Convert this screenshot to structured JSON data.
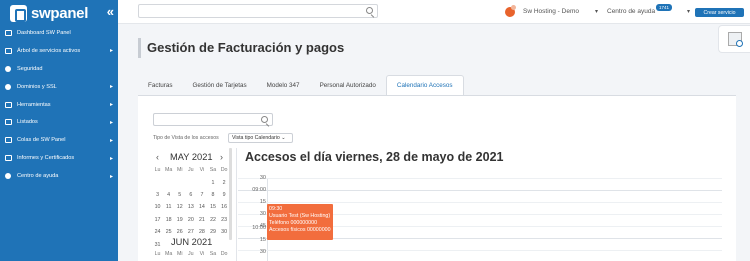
{
  "brand": {
    "name": "swpanel",
    "accent": "#1f73b7",
    "event_color": "#f26d3d"
  },
  "sidebar": {
    "collapse_icon": "double-chevron-left",
    "items": [
      {
        "label": "Dashboard SW Panel",
        "icon": "dashboard-icon",
        "caret": ""
      },
      {
        "label": "Árbol de servicios activos",
        "icon": "tree-icon",
        "caret": "▸"
      },
      {
        "label": "Seguridad",
        "icon": "shield-icon",
        "caret": ""
      },
      {
        "label": "Dominios y SSL",
        "icon": "gear-icon",
        "caret": "▸"
      },
      {
        "label": "Herramientas",
        "icon": "tools-icon",
        "caret": "▸"
      },
      {
        "label": "Listados",
        "icon": "list-icon",
        "caret": "▸"
      },
      {
        "label": "Colas de SW Panel",
        "icon": "layers-icon",
        "caret": "▸"
      },
      {
        "label": "Informes y Certificados",
        "icon": "report-icon",
        "caret": "▸"
      },
      {
        "label": "Centro de ayuda",
        "icon": "help-icon",
        "caret": "▸"
      }
    ]
  },
  "topbar": {
    "search_placeholder": "",
    "account": "Sw Hosting - Demo",
    "account_caret": "▾",
    "help": "Centro de ayuda",
    "help_badge": "1741",
    "help_caret": "▾",
    "new_service": "Crear servicio"
  },
  "page": {
    "title": "Gestión de Facturación y pagos",
    "tabs": [
      {
        "label": "Facturas"
      },
      {
        "label": "Gestión de Tarjetas"
      },
      {
        "label": "Modelo 347"
      },
      {
        "label": "Personal Autorizado"
      },
      {
        "label": "Calendario Accesos"
      }
    ],
    "active_tab": "Calendario Accesos"
  },
  "accesses": {
    "search_value": "",
    "view_label": "Tipo de Vista de los accesos",
    "view_value": "Vista tipo Calendario",
    "month1": "MAY 2021",
    "month2": "JUN 2021",
    "prev": "‹",
    "next": "›",
    "weekdays": [
      "Lu",
      "Ma",
      "Mi",
      "Ju",
      "Vi",
      "Sa",
      "Do"
    ],
    "may_weeks": [
      [
        "",
        "",
        "",
        "",
        "",
        "1",
        "2"
      ],
      [
        "3",
        "4",
        "5",
        "6",
        "7",
        "8",
        "9"
      ],
      [
        "10",
        "11",
        "12",
        "13",
        "14",
        "15",
        "16"
      ],
      [
        "17",
        "18",
        "19",
        "20",
        "21",
        "22",
        "23"
      ],
      [
        "24",
        "25",
        "26",
        "27",
        "28",
        "29",
        "30"
      ],
      [
        "31",
        "",
        "",
        "",
        "",
        "",
        ""
      ]
    ],
    "jun_weekdays": [
      "Lu",
      "Ma",
      "Mi",
      "Ju",
      "Vi",
      "Sa",
      "Do"
    ],
    "day_title": "Accesos el día viernes, 28 de mayo de 2021",
    "timeline": [
      "30",
      "09:00",
      "15",
      "30",
      "45",
      "10:00",
      "15",
      "30"
    ],
    "event": {
      "time": "09:30",
      "line1": "Usuario Test (Sw Hosting)",
      "line2": "Teléfono 000000000",
      "line3": "Accesos físicos 00000000"
    }
  }
}
